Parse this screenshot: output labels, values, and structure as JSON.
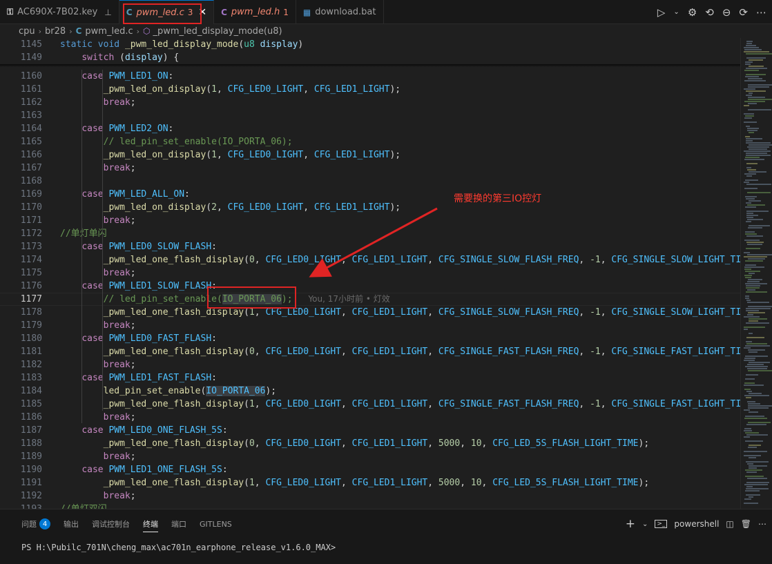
{
  "tabs": [
    {
      "icon": "key-file-icon",
      "label": "AC690X-7B02.key",
      "badge": "",
      "pinned": true,
      "active": false,
      "italic": false
    },
    {
      "icon": "c-file-icon",
      "label": "pwm_led.c",
      "badge": "3",
      "active": true,
      "italic": true
    },
    {
      "icon": "c-header-icon",
      "label": "pwm_led.h",
      "badge": "1",
      "active": false,
      "italic": true
    },
    {
      "icon": "bat-file-icon",
      "label": "download.bat",
      "badge": "",
      "active": false,
      "italic": false
    }
  ],
  "breadcrumb": {
    "p1": "cpu",
    "p2": "br28",
    "p3": "pwm_led.c",
    "p4": "_pwm_led_display_mode(u8)"
  },
  "sticky": [
    {
      "n": "1145",
      "tokens": [
        [
          "k",
          "static "
        ],
        [
          "k",
          "void "
        ],
        [
          "f",
          "_pwm_led_display_mode"
        ],
        [
          "p",
          "("
        ],
        [
          "t",
          "u8 "
        ],
        [
          "v",
          "display"
        ],
        [
          "p",
          ")"
        ]
      ]
    },
    {
      "n": "1149",
      "tokens": [
        [
          "p",
          "    "
        ],
        [
          "c",
          "switch "
        ],
        [
          "p",
          "("
        ],
        [
          "v",
          "display"
        ],
        [
          "p",
          ") {"
        ]
      ]
    }
  ],
  "lines": [
    {
      "n": "1160",
      "tokens": [
        [
          "p",
          "    "
        ],
        [
          "c",
          "case "
        ],
        [
          "m",
          "PWM_LED1_ON"
        ],
        [
          "p",
          ":"
        ]
      ]
    },
    {
      "n": "1161",
      "tokens": [
        [
          "p",
          "        "
        ],
        [
          "f",
          "_pwm_led_on_display"
        ],
        [
          "p",
          "("
        ],
        [
          "n",
          "1"
        ],
        [
          "p",
          ", "
        ],
        [
          "m",
          "CFG_LED0_LIGHT"
        ],
        [
          "p",
          ", "
        ],
        [
          "m",
          "CFG_LED1_LIGHT"
        ],
        [
          "p",
          ");"
        ]
      ]
    },
    {
      "n": "1162",
      "tokens": [
        [
          "p",
          "        "
        ],
        [
          "c",
          "break"
        ],
        [
          "p",
          ";"
        ]
      ]
    },
    {
      "n": "1163",
      "tokens": []
    },
    {
      "n": "1164",
      "tokens": [
        [
          "p",
          "    "
        ],
        [
          "c",
          "case "
        ],
        [
          "m",
          "PWM_LED2_ON"
        ],
        [
          "p",
          ":"
        ]
      ]
    },
    {
      "n": "1165",
      "tokens": [
        [
          "p",
          "        "
        ],
        [
          "cm",
          "// led_pin_set_enable(IO_PORTA_06);"
        ]
      ]
    },
    {
      "n": "1166",
      "tokens": [
        [
          "p",
          "        "
        ],
        [
          "f",
          "_pwm_led_on_display"
        ],
        [
          "p",
          "("
        ],
        [
          "n",
          "1"
        ],
        [
          "p",
          ", "
        ],
        [
          "m",
          "CFG_LED0_LIGHT"
        ],
        [
          "p",
          ", "
        ],
        [
          "m",
          "CFG_LED1_LIGHT"
        ],
        [
          "p",
          ");"
        ]
      ]
    },
    {
      "n": "1167",
      "tokens": [
        [
          "p",
          "        "
        ],
        [
          "c",
          "break"
        ],
        [
          "p",
          ";"
        ]
      ]
    },
    {
      "n": "1168",
      "tokens": []
    },
    {
      "n": "1169",
      "tokens": [
        [
          "p",
          "    "
        ],
        [
          "c",
          "case "
        ],
        [
          "m",
          "PWM_LED_ALL_ON"
        ],
        [
          "p",
          ":"
        ]
      ]
    },
    {
      "n": "1170",
      "tokens": [
        [
          "p",
          "        "
        ],
        [
          "f",
          "_pwm_led_on_display"
        ],
        [
          "p",
          "("
        ],
        [
          "n",
          "2"
        ],
        [
          "p",
          ", "
        ],
        [
          "m",
          "CFG_LED0_LIGHT"
        ],
        [
          "p",
          ", "
        ],
        [
          "m",
          "CFG_LED1_LIGHT"
        ],
        [
          "p",
          ");"
        ]
      ]
    },
    {
      "n": "1171",
      "tokens": [
        [
          "p",
          "        "
        ],
        [
          "c",
          "break"
        ],
        [
          "p",
          ";"
        ]
      ]
    },
    {
      "n": "1172",
      "tokens": [
        [
          "cm",
          "//单灯单闪"
        ]
      ]
    },
    {
      "n": "1173",
      "tokens": [
        [
          "p",
          "    "
        ],
        [
          "c",
          "case "
        ],
        [
          "m",
          "PWM_LED0_SLOW_FLASH"
        ],
        [
          "p",
          ":"
        ]
      ]
    },
    {
      "n": "1174",
      "tokens": [
        [
          "p",
          "        "
        ],
        [
          "f",
          "_pwm_led_one_flash_display"
        ],
        [
          "p",
          "("
        ],
        [
          "n",
          "0"
        ],
        [
          "p",
          ", "
        ],
        [
          "m",
          "CFG_LED0_LIGHT"
        ],
        [
          "p",
          ", "
        ],
        [
          "m",
          "CFG_LED1_LIGHT"
        ],
        [
          "p",
          ", "
        ],
        [
          "m",
          "CFG_SINGLE_SLOW_FLASH_FREQ"
        ],
        [
          "p",
          ", "
        ],
        [
          "n",
          "-1"
        ],
        [
          "p",
          ", "
        ],
        [
          "m",
          "CFG_SINGLE_SLOW_LIGHT_TIME"
        ]
      ]
    },
    {
      "n": "1175",
      "tokens": [
        [
          "p",
          "        "
        ],
        [
          "c",
          "break"
        ],
        [
          "p",
          ";"
        ]
      ]
    },
    {
      "n": "1176",
      "tokens": [
        [
          "p",
          "    "
        ],
        [
          "c",
          "case "
        ],
        [
          "m",
          "PWM_LED1_SLOW_FLASH"
        ],
        [
          "p",
          ":"
        ]
      ]
    },
    {
      "n": "1177",
      "current": true,
      "tokens": [
        [
          "p",
          "        "
        ],
        [
          "cm",
          "// led_pin_set_enable("
        ],
        [
          "cmio",
          "IO_PORTA_06"
        ],
        [
          "cm",
          ");"
        ]
      ],
      "blame": "You, 17小时前 • 灯效"
    },
    {
      "n": "1178",
      "tokens": [
        [
          "p",
          "        "
        ],
        [
          "f",
          "_pwm_led_one_flash_display"
        ],
        [
          "p",
          "("
        ],
        [
          "n",
          "1"
        ],
        [
          "p",
          ", "
        ],
        [
          "m",
          "CFG_LED0_LIGHT"
        ],
        [
          "p",
          ", "
        ],
        [
          "m",
          "CFG_LED1_LIGHT"
        ],
        [
          "p",
          ", "
        ],
        [
          "m",
          "CFG_SINGLE_SLOW_FLASH_FREQ"
        ],
        [
          "p",
          ", "
        ],
        [
          "n",
          "-1"
        ],
        [
          "p",
          ", "
        ],
        [
          "m",
          "CFG_SINGLE_SLOW_LIGHT_TIME"
        ]
      ]
    },
    {
      "n": "1179",
      "tokens": [
        [
          "p",
          "        "
        ],
        [
          "c",
          "break"
        ],
        [
          "p",
          ";"
        ]
      ]
    },
    {
      "n": "1180",
      "tokens": [
        [
          "p",
          "    "
        ],
        [
          "c",
          "case "
        ],
        [
          "m",
          "PWM_LED0_FAST_FLASH"
        ],
        [
          "p",
          ":"
        ]
      ]
    },
    {
      "n": "1181",
      "tokens": [
        [
          "p",
          "        "
        ],
        [
          "f",
          "_pwm_led_one_flash_display"
        ],
        [
          "p",
          "("
        ],
        [
          "n",
          "0"
        ],
        [
          "p",
          ", "
        ],
        [
          "m",
          "CFG_LED0_LIGHT"
        ],
        [
          "p",
          ", "
        ],
        [
          "m",
          "CFG_LED1_LIGHT"
        ],
        [
          "p",
          ", "
        ],
        [
          "m",
          "CFG_SINGLE_FAST_FLASH_FREQ"
        ],
        [
          "p",
          ", "
        ],
        [
          "n",
          "-1"
        ],
        [
          "p",
          ", "
        ],
        [
          "m",
          "CFG_SINGLE_FAST_LIGHT_TIME"
        ]
      ]
    },
    {
      "n": "1182",
      "tokens": [
        [
          "p",
          "        "
        ],
        [
          "c",
          "break"
        ],
        [
          "p",
          ";"
        ]
      ]
    },
    {
      "n": "1183",
      "tokens": [
        [
          "p",
          "    "
        ],
        [
          "c",
          "case "
        ],
        [
          "m",
          "PWM_LED1_FAST_FLASH"
        ],
        [
          "p",
          ":"
        ]
      ]
    },
    {
      "n": "1184",
      "tokens": [
        [
          "p",
          "        "
        ],
        [
          "f",
          "led_pin_set_enable"
        ],
        [
          "p",
          "("
        ],
        [
          "mio",
          "IO_PORTA_06"
        ],
        [
          "p",
          ");"
        ]
      ]
    },
    {
      "n": "1185",
      "tokens": [
        [
          "p",
          "        "
        ],
        [
          "f",
          "_pwm_led_one_flash_display"
        ],
        [
          "p",
          "("
        ],
        [
          "n",
          "1"
        ],
        [
          "p",
          ", "
        ],
        [
          "m",
          "CFG_LED0_LIGHT"
        ],
        [
          "p",
          ", "
        ],
        [
          "m",
          "CFG_LED1_LIGHT"
        ],
        [
          "p",
          ", "
        ],
        [
          "m",
          "CFG_SINGLE_FAST_FLASH_FREQ"
        ],
        [
          "p",
          ", "
        ],
        [
          "n",
          "-1"
        ],
        [
          "p",
          ", "
        ],
        [
          "m",
          "CFG_SINGLE_FAST_LIGHT_TIME"
        ]
      ]
    },
    {
      "n": "1186",
      "tokens": [
        [
          "p",
          "        "
        ],
        [
          "c",
          "break"
        ],
        [
          "p",
          ";"
        ]
      ]
    },
    {
      "n": "1187",
      "tokens": [
        [
          "p",
          "    "
        ],
        [
          "c",
          "case "
        ],
        [
          "m",
          "PWM_LED0_ONE_FLASH_5S"
        ],
        [
          "p",
          ":"
        ]
      ]
    },
    {
      "n": "1188",
      "tokens": [
        [
          "p",
          "        "
        ],
        [
          "f",
          "_pwm_led_one_flash_display"
        ],
        [
          "p",
          "("
        ],
        [
          "n",
          "0"
        ],
        [
          "p",
          ", "
        ],
        [
          "m",
          "CFG_LED0_LIGHT"
        ],
        [
          "p",
          ", "
        ],
        [
          "m",
          "CFG_LED1_LIGHT"
        ],
        [
          "p",
          ", "
        ],
        [
          "n",
          "5000"
        ],
        [
          "p",
          ", "
        ],
        [
          "n",
          "10"
        ],
        [
          "p",
          ", "
        ],
        [
          "m",
          "CFG_LED_5S_FLASH_LIGHT_TIME"
        ],
        [
          "p",
          ");"
        ]
      ]
    },
    {
      "n": "1189",
      "tokens": [
        [
          "p",
          "        "
        ],
        [
          "c",
          "break"
        ],
        [
          "p",
          ";"
        ]
      ]
    },
    {
      "n": "1190",
      "tokens": [
        [
          "p",
          "    "
        ],
        [
          "c",
          "case "
        ],
        [
          "m",
          "PWM_LED1_ONE_FLASH_5S"
        ],
        [
          "p",
          ":"
        ]
      ]
    },
    {
      "n": "1191",
      "tokens": [
        [
          "p",
          "        "
        ],
        [
          "f",
          "_pwm_led_one_flash_display"
        ],
        [
          "p",
          "("
        ],
        [
          "n",
          "1"
        ],
        [
          "p",
          ", "
        ],
        [
          "m",
          "CFG_LED0_LIGHT"
        ],
        [
          "p",
          ", "
        ],
        [
          "m",
          "CFG_LED1_LIGHT"
        ],
        [
          "p",
          ", "
        ],
        [
          "n",
          "5000"
        ],
        [
          "p",
          ", "
        ],
        [
          "n",
          "10"
        ],
        [
          "p",
          ", "
        ],
        [
          "m",
          "CFG_LED_5S_FLASH_LIGHT_TIME"
        ],
        [
          "p",
          ");"
        ]
      ]
    },
    {
      "n": "1192",
      "tokens": [
        [
          "p",
          "        "
        ],
        [
          "c",
          "break"
        ],
        [
          "p",
          ";"
        ]
      ]
    },
    {
      "n": "1193",
      "tokens": [
        [
          "cm",
          "//单灯双闪"
        ]
      ]
    }
  ],
  "annotation": "需要换的第三IO控灯",
  "panel": {
    "tabs": [
      "问题",
      "输出",
      "调试控制台",
      "终端",
      "端口",
      "GITLENS"
    ],
    "problems_count": "4",
    "active_tab": "终端",
    "shell": "powershell",
    "prompt": "PS H:\\Pubilc_701N\\cheng_max\\ac701n_earphone_release_v1.6.0_MAX>"
  },
  "colors": {
    "accent": "#0078d4",
    "annotation_red": "#e02424",
    "editor_bg": "#1f1f1f"
  }
}
